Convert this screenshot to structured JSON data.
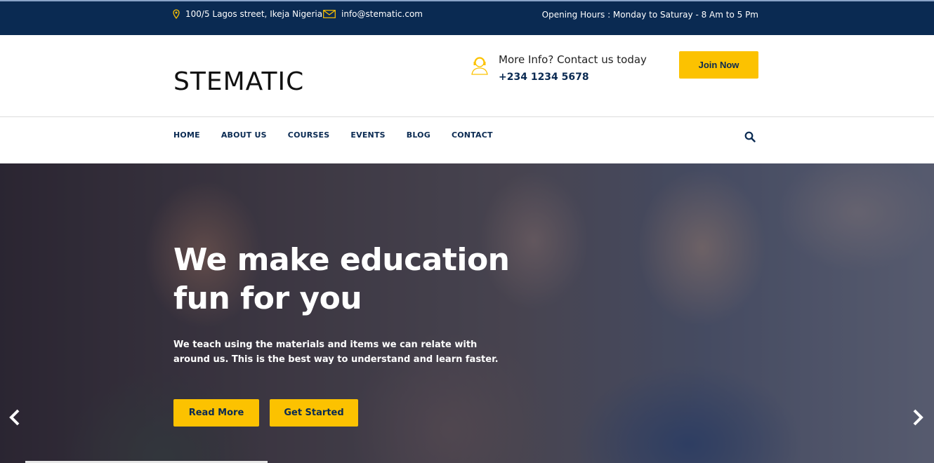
{
  "topbar": {
    "address": "100/5 Lagos street, Ikeja Nigeria",
    "email": "info@stematic.com",
    "hours": "Opening Hours : Monday to Saturay - 8 Am to 5 Pm",
    "address_icon": "location-pin-icon",
    "email_icon": "envelope-icon"
  },
  "header": {
    "logo": "STEMATIC",
    "contact_label": "More Info? Contact us today",
    "contact_phone": "+234 1234 5678",
    "contact_icon": "support-agent-icon",
    "join_label": "Join Now"
  },
  "nav": {
    "items": [
      "HOME",
      "ABOUT US",
      "COURSES",
      "EVENTS",
      "BLOG",
      "CONTACT"
    ],
    "search_icon": "search-icon"
  },
  "hero": {
    "title_line1": "We make education",
    "title_line2": "fun for you",
    "subtitle": "We teach using the materials and items we can relate with around us. This is the best way to understand and learn faster.",
    "read_more_label": "Read More",
    "get_started_label": "Get Started",
    "prev_icon": "chevron-left-icon",
    "next_icon": "chevron-right-icon"
  },
  "colors": {
    "navy": "#0a2a52",
    "accent": "#fcc200"
  }
}
